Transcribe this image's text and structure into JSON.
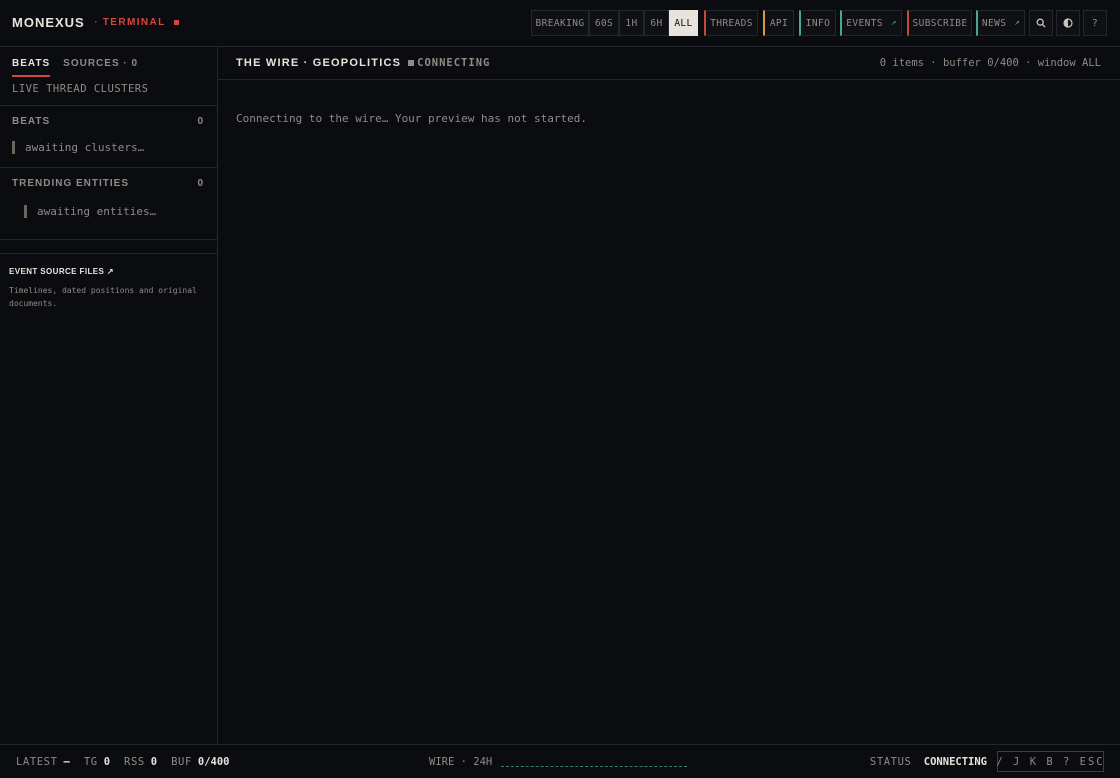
{
  "brand": {
    "name": "MONEXUS",
    "separator": "·",
    "tag": "TERMINAL"
  },
  "nav": {
    "breaking": "BREAKING",
    "w60s": "60S",
    "w1h": "1H",
    "w6h": "6H",
    "all": "ALL",
    "threads": "THREADS",
    "api": "API",
    "info": "INFO",
    "events": "EVENTS",
    "events_arrow": "↗",
    "subscribe": "SUBSCRIBE",
    "news": "NEWS",
    "news_arrow": "↗",
    "search_icon": "search-icon",
    "theme_icon": "contrast-icon",
    "help": "?"
  },
  "sidebar": {
    "tab_beats": "BEATS",
    "tab_sources": "SOURCES · 0",
    "subtitle": "LIVE THREAD CLUSTERS",
    "beats": {
      "title": "BEATS",
      "count": "0",
      "placeholder": "awaiting clusters…"
    },
    "entities": {
      "title": "TRENDING ENTITIES",
      "count": "0",
      "placeholder": "awaiting entities…"
    },
    "promo": {
      "title": "EVENT SOURCE FILES ↗",
      "description": "Timelines, dated positions and original documents."
    }
  },
  "main": {
    "title": "THE WIRE · GEOPOLITICS",
    "status": "CONNECTING",
    "meta": "0 items · buffer 0/400 · window ALL",
    "message": "Connecting to the wire… Your preview has not started."
  },
  "footer": {
    "latest_label": "LATEST",
    "latest_value": "—",
    "tg_label": "TG",
    "tg_value": "0",
    "rss_label": "RSS",
    "rss_value": "0",
    "buf_label": "BUF",
    "buf_value": "0/400",
    "wire_label": "WIRE · 24H",
    "status_label": "STATUS",
    "status_value": "CONNECTING",
    "keys": "/ J K B ? ESC"
  },
  "colors": {
    "background": "#0b0c0f",
    "accent_red": "#d3473d",
    "accent_teal": "#4aa596",
    "accent_amber": "#d59a45",
    "text_bright": "#e8e4dc",
    "text_muted": "#8f8c85"
  }
}
